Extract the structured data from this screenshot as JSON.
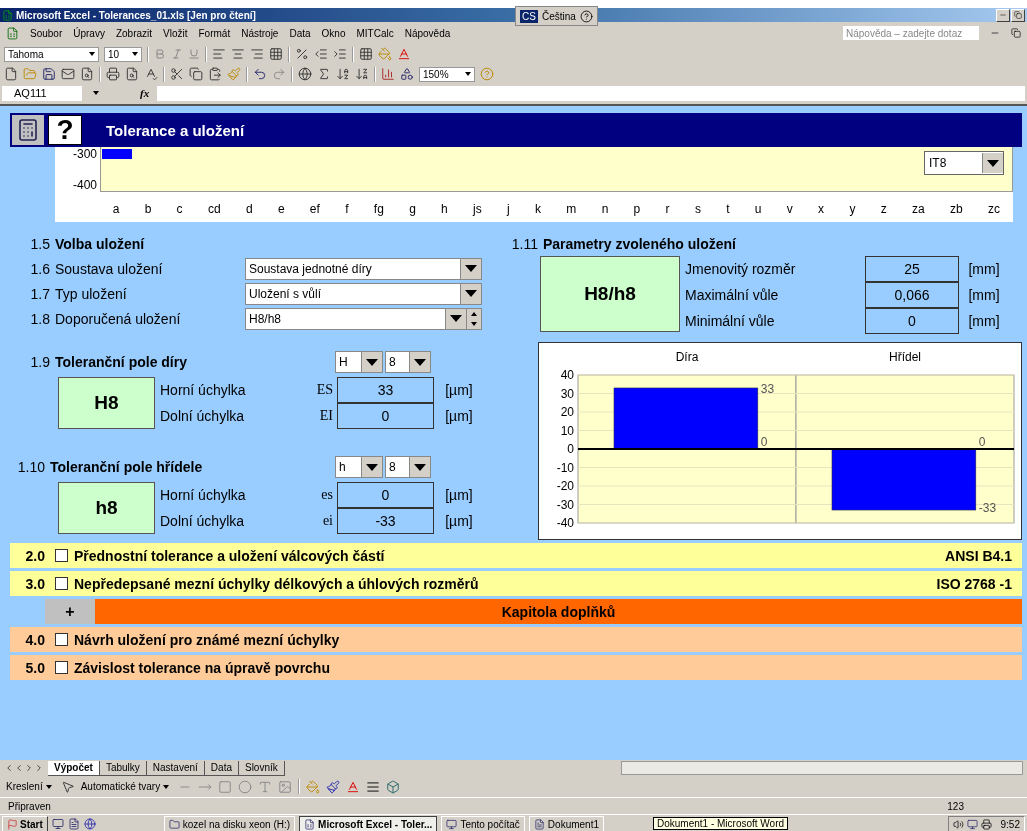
{
  "window": {
    "title": "Microsoft Excel - Tolerances_01.xls  [Jen pro čtení]",
    "language_code": "CS",
    "language": "Čeština"
  },
  "menu": [
    "Soubor",
    "Úpravy",
    "Zobrazit",
    "Vložit",
    "Formát",
    "Nástroje",
    "Data",
    "Okno",
    "MITCalc",
    "Nápověda"
  ],
  "help_search": {
    "placeholder": "Nápověda – zadejte dotaz"
  },
  "formatting_toolbar": {
    "font": "Tahoma",
    "size": "10"
  },
  "standard_toolbar": {
    "zoom": "150%"
  },
  "formula_bar": {
    "cell": "AQ111",
    "function_label": "fx"
  },
  "sheet": {
    "header": {
      "help": "?",
      "title": "Tolerance a uložení"
    },
    "overview_chart": {
      "y_labels": [
        "-300",
        "-400"
      ],
      "grade": "IT8",
      "categories": [
        "a",
        "b",
        "c",
        "cd",
        "d",
        "e",
        "ef",
        "f",
        "fg",
        "g",
        "h",
        "js",
        "j",
        "k",
        "m",
        "n",
        "p",
        "r",
        "s",
        "t",
        "u",
        "v",
        "x",
        "y",
        "z",
        "za",
        "zb",
        "zc"
      ]
    },
    "fit_selection": {
      "number": "1.5",
      "title": "Volba uložení",
      "rows": [
        {
          "number": "1.6",
          "label": "Soustava uložení",
          "value": "Soustava jednotné díry",
          "kind": "dropdown"
        },
        {
          "number": "1.7",
          "label": "Typ uložení",
          "value": "Uložení s vůlí",
          "kind": "dropdown"
        },
        {
          "number": "1.8",
          "label": "Doporučená uložení",
          "value": "H8/h8",
          "kind": "spin-dropdown"
        }
      ]
    },
    "zones": [
      {
        "number": "1.9",
        "title": "Toleranční pole díry",
        "letter": "H",
        "grade": "8",
        "designation": "H8",
        "rows": [
          {
            "label": "Horní úchylka",
            "symbol": "ES",
            "value": "33",
            "unit": "[µm]"
          },
          {
            "label": "Dolní úchylka",
            "symbol": "EI",
            "value": "0",
            "unit": "[µm]"
          }
        ]
      },
      {
        "number": "1.10",
        "title": "Toleranční pole hřídele",
        "letter": "h",
        "grade": "8",
        "designation": "h8",
        "rows": [
          {
            "label": "Horní úchylka",
            "symbol": "es",
            "value": "0",
            "unit": "[µm]"
          },
          {
            "label": "Dolní úchylka",
            "symbol": "ei",
            "value": "-33",
            "unit": "[µm]"
          }
        ]
      }
    ],
    "fit_parameters": {
      "number": "1.11",
      "title": "Parametry zvoleného uložení",
      "designation": "H8/h8",
      "rows": [
        {
          "label": "Jmenovitý rozměr",
          "value": "25",
          "unit": "[mm]"
        },
        {
          "label": "Maximální vůle",
          "value": "0,066",
          "unit": "[mm]"
        },
        {
          "label": "Minimální vůle",
          "value": "0",
          "unit": "[mm]"
        }
      ]
    },
    "deviation_chart": {
      "chart_data": {
        "type": "bar",
        "categories": [
          "Díra",
          "Hřídel"
        ],
        "series": [
          {
            "color": "#0000ff",
            "values": [
              33,
              -33
            ]
          }
        ],
        "ylim": [
          -40,
          40
        ],
        "yticks": [
          40,
          30,
          20,
          10,
          0,
          -10,
          -20,
          -30,
          -40
        ],
        "grid": true,
        "annotations": [
          "33",
          "0",
          "0",
          "-33"
        ]
      }
    },
    "chapters": [
      {
        "kind": "chapter",
        "number": "2.0",
        "checked": false,
        "title": "Přednostní tolerance a uložení válcových částí",
        "standard": "ANSI B4.1",
        "color": "#ffff99"
      },
      {
        "kind": "chapter",
        "number": "3.0",
        "checked": false,
        "title": "Nepředepsané mezní úchylky délkových a úhlových rozměrů",
        "standard": "ISO 2768 -1",
        "color": "#ffff99"
      },
      {
        "kind": "group",
        "toggle": "+",
        "title": "Kapitola doplňků",
        "color": "#ff6600"
      },
      {
        "kind": "chapter",
        "number": "4.0",
        "checked": false,
        "title": "Návrh uložení pro známé mezní úchylky",
        "color": "#ffcc99"
      },
      {
        "kind": "chapter",
        "number": "5.0",
        "checked": false,
        "title": "Závislost tolerance na úpravě povrchu",
        "color": "#ffcc99"
      }
    ]
  },
  "sheet_tabs": [
    {
      "label": "Výpočet",
      "selected": true
    },
    {
      "label": "Tabulky",
      "selected": false
    },
    {
      "label": "Nastavení",
      "selected": false
    },
    {
      "label": "Data",
      "selected": false
    },
    {
      "label": "Slovník",
      "selected": false
    }
  ],
  "drawing_toolbar": {
    "draw_menu": "Kreslení",
    "autoshapes": "Automatické tvary"
  },
  "status_bar": {
    "status": "Připraven",
    "indicator": "123"
  },
  "taskbar": {
    "start": "Start",
    "tasks": [
      {
        "label": "kozel na disku xeon (H:)",
        "selected": false
      },
      {
        "label": "Microsoft Excel - Toler...",
        "selected": true
      },
      {
        "label": "Tento počítač",
        "selected": false
      },
      {
        "label": "Dokument1",
        "selected": false
      }
    ],
    "tooltip": "Dokument1 - Microsoft Word",
    "clock": "9:52"
  }
}
